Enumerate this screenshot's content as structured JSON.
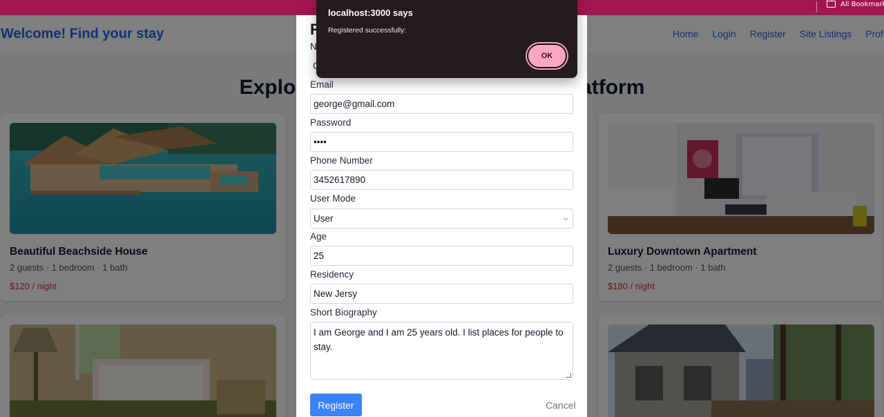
{
  "bookmarks_bar": {
    "all_bookmarks": "All Bookmarks"
  },
  "navbar": {
    "brand": "Welcome! Find your stay",
    "links": [
      "Home",
      "Login",
      "Register",
      "Site Listings",
      "Profile"
    ]
  },
  "page": {
    "title": "Explore                                              atform"
  },
  "listings": [
    {
      "title": "Beautiful Beachside House",
      "meta": "2 guests · 1 bedroom · 1 bath",
      "price": "$120 / night"
    },
    {
      "title": "Luxury Downtown Apartment",
      "meta": "2 guests · 1 bedroom · 1 bath",
      "price": "$180 / night"
    }
  ],
  "modal": {
    "title": "R",
    "hidden_label": "N",
    "hidden_value": "G",
    "fields": {
      "email": {
        "label": "Email",
        "value": "george@gmail.com"
      },
      "password": {
        "label": "Password",
        "value": "••••"
      },
      "phone": {
        "label": "Phone Number",
        "value": "3452617890"
      },
      "user_mode": {
        "label": "User Mode",
        "value": "User"
      },
      "age": {
        "label": "Age",
        "value": "25"
      },
      "residency": {
        "label": "Residency",
        "value": "New Jersy"
      },
      "bio": {
        "label": "Short Biography",
        "value": "I am George and I am 25 years old. I list places for people to stay."
      }
    },
    "register_label": "Register",
    "cancel_label": "Cancel"
  },
  "alert": {
    "title": "localhost:3000 says",
    "message": "Registered successfully:",
    "ok_label": "OK"
  },
  "colors": {
    "brand": "#2563eb",
    "bookmarks_bar": "#a3154f",
    "price": "#dc2626",
    "register_button": "#3b82f6",
    "alert_bg": "#231b1c",
    "ok_button": "#f9a7c1"
  }
}
